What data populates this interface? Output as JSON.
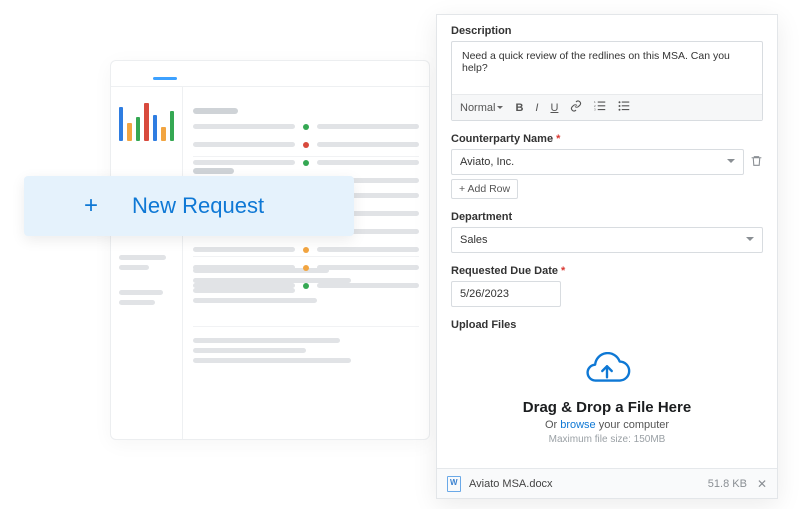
{
  "new_request": {
    "plus": "+",
    "label": "New Request"
  },
  "form": {
    "description": {
      "label": "Description",
      "value": "Need a quick review of the redlines on this MSA. Can you help?",
      "toolbar": {
        "format_select": "Normal",
        "bold": "B",
        "italic": "I",
        "underline": "U",
        "link": "🔗",
        "ol": "≣",
        "ul": "☰"
      }
    },
    "counterparty": {
      "label": "Counterparty Name",
      "required_marker": "*",
      "value": "Aviato, Inc.",
      "add_row": "+ Add Row"
    },
    "department": {
      "label": "Department",
      "value": "Sales"
    },
    "due_date": {
      "label": "Requested Due Date",
      "required_marker": "*",
      "value": "5/26/2023"
    },
    "upload": {
      "label": "Upload Files",
      "dropzone_title": "Drag & Drop a File Here",
      "dropzone_or": "Or ",
      "dropzone_browse": "browse",
      "dropzone_rest": " your computer",
      "hint": "Maximum file size: 150MB",
      "file": {
        "name": "Aviato MSA.docx",
        "size": "51.8 KB"
      }
    }
  },
  "bg": {
    "bars": [
      {
        "h": 34,
        "c": "#2f7de1"
      },
      {
        "h": 18,
        "c": "#f2a541"
      },
      {
        "h": 24,
        "c": "#35a853"
      },
      {
        "h": 38,
        "c": "#d84a3d"
      },
      {
        "h": 26,
        "c": "#2f7de1"
      },
      {
        "h": 14,
        "c": "#f2a541"
      },
      {
        "h": 30,
        "c": "#35a853"
      }
    ],
    "dots": [
      "#35a853",
      "#d84a3d",
      "#35a853",
      "#f2a541",
      "#f2a541",
      "#35a853",
      "#f2a541",
      "#d84a3d"
    ],
    "accent": "#3da1ff"
  }
}
